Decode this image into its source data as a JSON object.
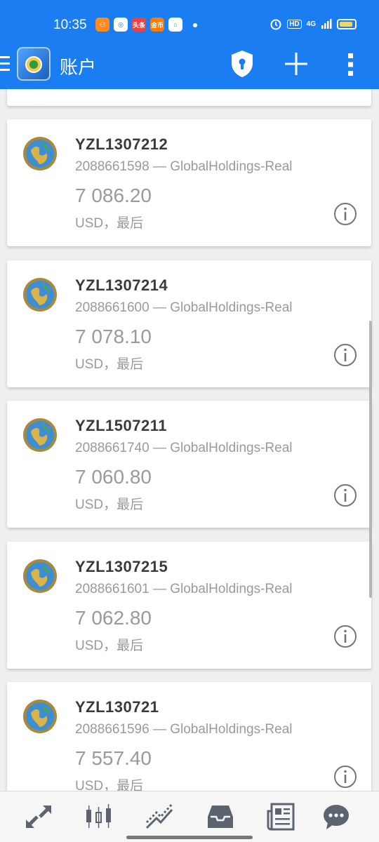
{
  "status_bar": {
    "time": "10:35",
    "notification_icons": [
      "pinduoduo-icon",
      "app-icon",
      "toutiao-icon",
      "rewards-icon",
      "home-icon"
    ],
    "toutiao_text": "头条",
    "rewards_text": "金币",
    "network": "4G",
    "hd": "HD"
  },
  "app_bar": {
    "title": "账户"
  },
  "accounts": [
    {
      "name": "YZL1307212",
      "server": "2088661598 — GlobalHoldings-Real",
      "balance": "7 086.20",
      "currency": "USD，最后"
    },
    {
      "name": "YZL1307214",
      "server": "2088661600 — GlobalHoldings-Real",
      "balance": "7 078.10",
      "currency": "USD，最后"
    },
    {
      "name": "YZL1507211",
      "server": "2088661740 — GlobalHoldings-Real",
      "balance": "7 060.80",
      "currency": "USD，最后"
    },
    {
      "name": "YZL1307215",
      "server": "2088661601 — GlobalHoldings-Real",
      "balance": "7 062.80",
      "currency": "USD，最后"
    },
    {
      "name": "YZL130721",
      "server": "2088661596 — GlobalHoldings-Real",
      "balance": "7 557.40",
      "currency": "USD，最后"
    }
  ],
  "bottom_nav": [
    "quotes-icon",
    "chart-icon",
    "trade-icon",
    "history-icon",
    "news-icon",
    "chat-icon"
  ],
  "colors": {
    "primary": "#1a7ef2",
    "text_dark": "#3a3a3a",
    "text_gray": "#9a9a9a",
    "nav_icon": "#5b6470"
  }
}
